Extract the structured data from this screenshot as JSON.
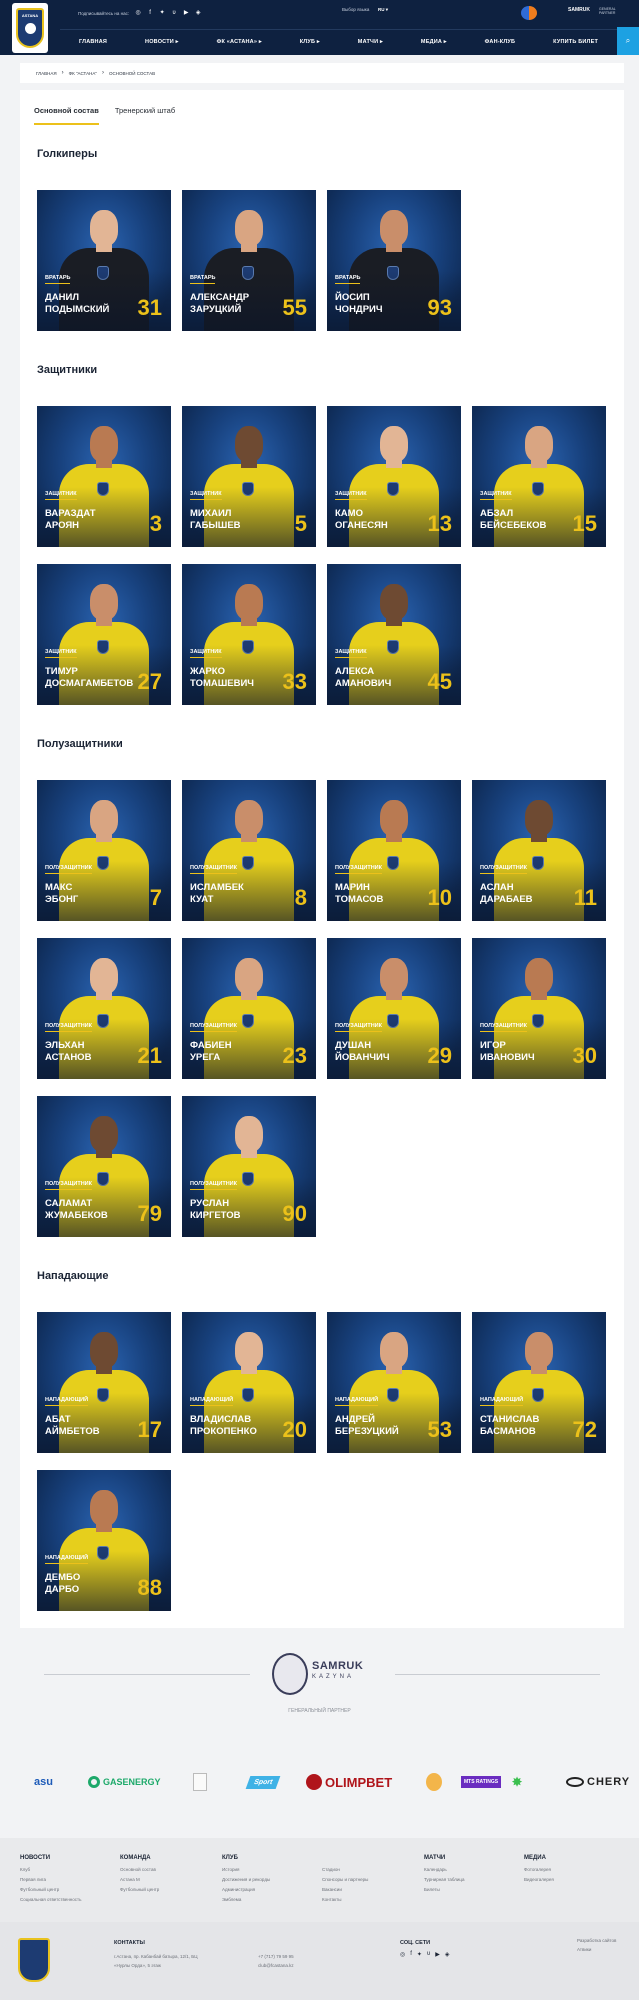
{
  "header": {
    "follow_label": "Подписывайтесь на нас:",
    "version_label": "Выбор языка",
    "lang": "RU",
    "partner": "SAMRUK",
    "partner_sub1": "GENERAL",
    "partner_sub2": "PARTNER",
    "nav": [
      "ГЛАВНАЯ",
      "НОВОСТИ",
      "ФК «АСТАНА»",
      "КЛУБ",
      "МАТЧИ",
      "МЕДИА",
      "ФАН-КЛУБ",
      "КУПИТЬ БИЛЕТ"
    ],
    "logo_text": "ASTANA"
  },
  "breadcrumb": [
    "ГЛАВНАЯ",
    "ФК \"АСТАНА\"",
    "ОСНОВНОЙ СОСТАВ"
  ],
  "tabs": [
    "Основной состав",
    "Тренерский штаб"
  ],
  "sections": [
    {
      "title": "Голкиперы",
      "players": [
        {
          "pos": "ВРАТАРЬ",
          "name1": "ДАНИЛ",
          "name2": "ПОДЫМСКИЙ",
          "num": "31"
        },
        {
          "pos": "ВРАТАРЬ",
          "name1": "АЛЕКСАНДР",
          "name2": "ЗАРУЦКИЙ",
          "num": "55"
        },
        {
          "pos": "ВРАТАРЬ",
          "name1": "ЙОСИП",
          "name2": "ЧОНДРИЧ",
          "num": "93"
        }
      ]
    },
    {
      "title": "Защитники",
      "players": [
        {
          "pos": "ЗАЩИТНИК",
          "name1": "ВАРАЗДАТ",
          "name2": "АРОЯН",
          "num": "3"
        },
        {
          "pos": "ЗАЩИТНИК",
          "name1": "МИХАИЛ",
          "name2": "ГАБЫШЕВ",
          "num": "5"
        },
        {
          "pos": "ЗАЩИТНИК",
          "name1": "КАМО",
          "name2": "ОГАНЕСЯН",
          "num": "13"
        },
        {
          "pos": "ЗАЩИТНИК",
          "name1": "АБЗАЛ",
          "name2": "БЕЙСЕБЕКОВ",
          "num": "15"
        },
        {
          "pos": "ЗАЩИТНИК",
          "name1": "ТИМУР",
          "name2": "ДОСМАГАМБЕТОВ",
          "num": "27"
        },
        {
          "pos": "ЗАЩИТНИК",
          "name1": "ЖАРКО",
          "name2": "ТОМАШЕВИЧ",
          "num": "33"
        },
        {
          "pos": "ЗАЩИТНИК",
          "name1": "АЛЕКСА",
          "name2": "АМАНОВИЧ",
          "num": "45"
        }
      ]
    },
    {
      "title": "Полузащитники",
      "players": [
        {
          "pos": "ПОЛУЗАЩИТНИК",
          "name1": "МАКС",
          "name2": "ЭБОНГ",
          "num": "7"
        },
        {
          "pos": "ПОЛУЗАЩИТНИК",
          "name1": "ИСЛАМБЕК",
          "name2": "КУАТ",
          "num": "8"
        },
        {
          "pos": "ПОЛУЗАЩИТНИК",
          "name1": "МАРИН",
          "name2": "ТОМАСОВ",
          "num": "10"
        },
        {
          "pos": "ПОЛУЗАЩИТНИК",
          "name1": "АСЛАН",
          "name2": "ДАРАБАЕВ",
          "num": "11"
        },
        {
          "pos": "ПОЛУЗАЩИТНИК",
          "name1": "ЭЛЬХАН",
          "name2": "АСТАНОВ",
          "num": "21"
        },
        {
          "pos": "ПОЛУЗАЩИТНИК",
          "name1": "ФАБИЕН",
          "name2": "УРЕГА",
          "num": "23"
        },
        {
          "pos": "ПОЛУЗАЩИТНИК",
          "name1": "ДУШАН",
          "name2": "ЙОВАНЧИЧ",
          "num": "29"
        },
        {
          "pos": "ПОЛУЗАЩИТНИК",
          "name1": "ИГОР",
          "name2": "ИВАНОВИЧ",
          "num": "30"
        },
        {
          "pos": "ПОЛУЗАЩИТНИК",
          "name1": "САЛАМАТ",
          "name2": "ЖУМАБЕКОВ",
          "num": "79"
        },
        {
          "pos": "ПОЛУЗАЩИТНИК",
          "name1": "РУСЛАН",
          "name2": "КИРГЕТОВ",
          "num": "90"
        }
      ]
    },
    {
      "title": "Нападающие",
      "players": [
        {
          "pos": "НАПАДАЮЩИЙ",
          "name1": "АБАТ",
          "name2": "АЙМБЕТОВ",
          "num": "17"
        },
        {
          "pos": "НАПАДАЮЩИЙ",
          "name1": "ВЛАДИСЛАВ",
          "name2": "ПРОКОПЕНКО",
          "num": "20"
        },
        {
          "pos": "НАПАДАЮЩИЙ",
          "name1": "АНДРЕЙ",
          "name2": "БЕРЕЗУЦКИЙ",
          "num": "53"
        },
        {
          "pos": "НАПАДАЮЩИЙ",
          "name1": "СТАНИСЛАВ",
          "name2": "БАСМАНОВ",
          "num": "72"
        },
        {
          "pos": "НАПАДАЮЩИЙ",
          "name1": "ДЕМБО",
          "name2": "ДАРБО",
          "num": "88"
        }
      ]
    }
  ],
  "general_partner": {
    "name": "SAMRUK",
    "sub": "KAZYNA",
    "label": "ГЕНЕРАЛЬНЫЙ ПАРТНЕР"
  },
  "partners": [
    "asu",
    "GASENERGY",
    "",
    "Sport",
    "OLIMPBET",
    "",
    "MTS RATINGS",
    "",
    "CHERY"
  ],
  "footer": {
    "cols": [
      {
        "h": "НОВОСТИ",
        "links": [
          "Клуб",
          "Первая лига",
          "Футбольный центр",
          "Социальная ответственность"
        ]
      },
      {
        "h": "КОМАНДА",
        "links": [
          "Основной состав",
          "Астана М",
          "Футбольный центр"
        ]
      },
      {
        "h": "КЛУБ",
        "links": [
          "История",
          "Достижения и рекорды",
          "Администрация",
          "Эмблема"
        ]
      },
      {
        "h": "",
        "links": [
          "Стадион",
          "Спонсоры и партнеры",
          "Вакансии",
          "Контакты"
        ]
      },
      {
        "h": "МАТЧИ",
        "links": [
          "Календарь",
          "Турнирная таблица",
          "Билеты"
        ]
      },
      {
        "h": "МЕДИА",
        "links": [
          "Фотогалерея",
          "Видеогалерея"
        ]
      }
    ],
    "contacts_h": "КОНТАКТЫ",
    "address1": "г.Астана, пр. Кабанбай батыра, 12/1, БЦ",
    "address2": "«Нурлы Орда», 5 этаж",
    "phone": "+7 (717) 79 59 95",
    "email": "club@fcastana.kz",
    "social_h": "СОЦ. СЕТИ",
    "dev1": "Разработка сайтов",
    "dev2": "Атвики"
  }
}
